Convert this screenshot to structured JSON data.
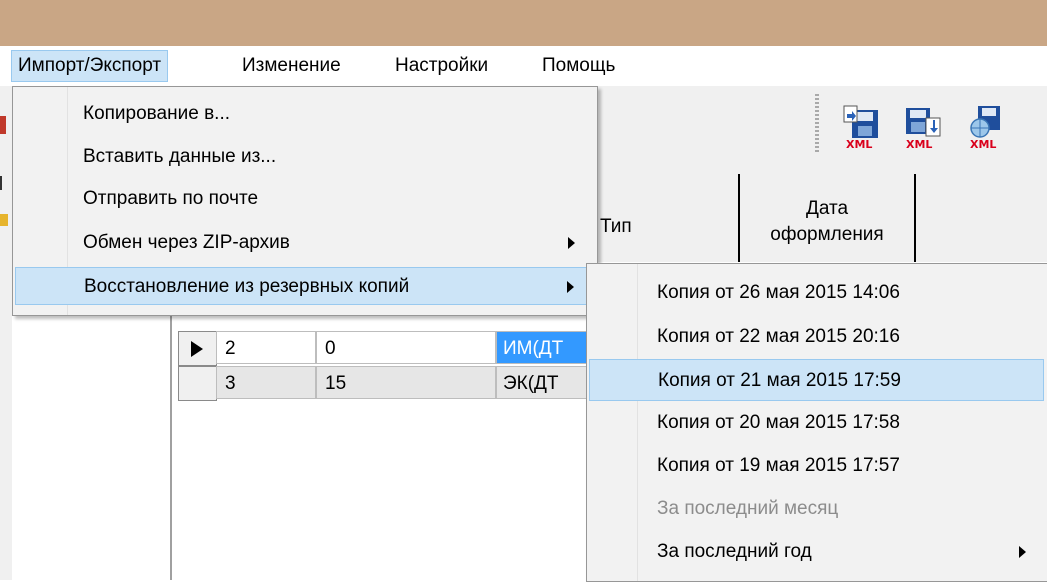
{
  "menubar": {
    "items": [
      {
        "label": "Импорт/Экспорт"
      },
      {
        "label": "Изменение"
      },
      {
        "label": "Настройки"
      },
      {
        "label": "Помощь"
      }
    ]
  },
  "toolbar": {
    "icons": [
      "import-xml-icon",
      "export-xml-icon",
      "xml-network-icon"
    ],
    "xml_text": "XML"
  },
  "grid": {
    "headers": {
      "type": "Тип",
      "date_line1": "Дата",
      "date_line2": "оформления"
    },
    "rows": [
      {
        "c1": "2",
        "c2": "0",
        "c3": "ИМ(ДТ"
      },
      {
        "c1": "3",
        "c2": "15",
        "c3": "ЭК(ДТ"
      }
    ]
  },
  "import_export_menu": {
    "items": [
      {
        "label": "Копирование в..."
      },
      {
        "label": "Вставить данные из..."
      },
      {
        "label": "Отправить по почте"
      },
      {
        "label": "Обмен через ZIP-архив"
      },
      {
        "label": "Восстановление из резервных копий"
      }
    ]
  },
  "backup_submenu": {
    "items": [
      {
        "label": "Копия от 26 мая 2015 14:06"
      },
      {
        "label": "Копия от 22 мая 2015 20:16"
      },
      {
        "label": "Копия от 21 мая 2015 17:59"
      },
      {
        "label": "Копия от 20 мая 2015 17:58"
      },
      {
        "label": "Копия от 19 мая 2015 17:57"
      },
      {
        "label": "За последний месяц"
      },
      {
        "label": "За последний год"
      }
    ]
  },
  "colors": {
    "titlebar": "#c9a685",
    "highlight": "#cce4f7",
    "selection": "#3399ff",
    "xml_red": "#d9001b",
    "disk_blue": "#1f4e9c"
  }
}
